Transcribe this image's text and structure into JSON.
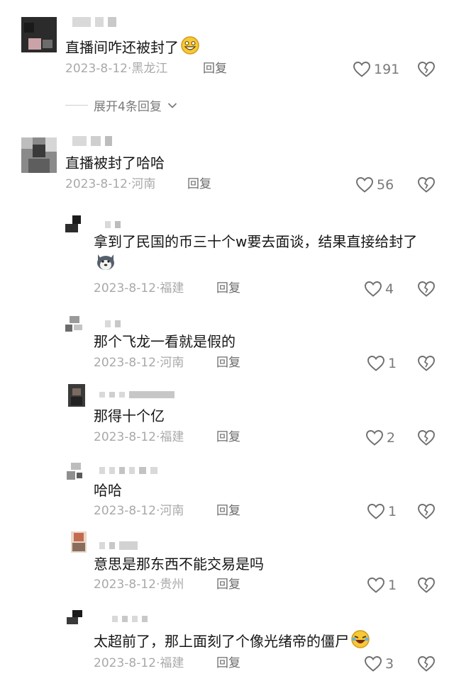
{
  "comments": [
    {
      "text": "直播间咋还被封了",
      "emoji": "grinning-face-emoji",
      "date": "2023-8-12",
      "location": "黑龙江",
      "reply": "回复",
      "likes": "191"
    },
    {
      "text": "直播被封了哈哈",
      "date": "2023-8-12",
      "location": "河南",
      "reply": "回复",
      "likes": "56"
    }
  ],
  "expand_label": "展开4条回复",
  "replies": [
    {
      "text": "拿到了民国的币三十个w要去面谈，结果直接给封了",
      "emoji": "husky-dog-emoji",
      "date": "2023-8-12",
      "location": "福建",
      "reply": "回复",
      "likes": "4"
    },
    {
      "text": "那个飞龙一看就是假的",
      "date": "2023-8-12",
      "location": "河南",
      "reply": "回复",
      "likes": "1"
    },
    {
      "text": "那得十个亿",
      "date": "2023-8-12",
      "location": "福建",
      "reply": "回复",
      "likes": "2"
    },
    {
      "text": "哈哈",
      "date": "2023-8-12",
      "location": "河南",
      "reply": "回复",
      "likes": "1"
    },
    {
      "text": "意思是那东西不能交易是吗",
      "date": "2023-8-12",
      "location": "贵州",
      "reply": "回复",
      "likes": "1"
    },
    {
      "text": "太超前了，那上面刻了个像光绪帝的僵尸",
      "emoji": "rolling-laughing-emoji",
      "date": "2023-8-12",
      "location": "福建",
      "reply": "回复",
      "likes": "3"
    }
  ],
  "dot": "·",
  "colors": {
    "meta": "#a9a9a9",
    "text": "#161616",
    "icon": "#7a7a7a"
  }
}
